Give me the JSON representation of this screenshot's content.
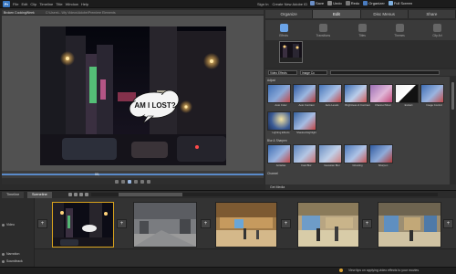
{
  "app": {
    "icon_letter": "Pr"
  },
  "menu": [
    "File",
    "Edit",
    "Clip",
    "Timeline",
    "Title",
    "Window",
    "Help"
  ],
  "topbar": {
    "sign_in": "Sign In",
    "create_id": "Create New Adobe ID"
  },
  "topbar_buttons": [
    {
      "label": "Save",
      "color": "#6b8fc7"
    },
    {
      "label": "Undo",
      "color": "#888888"
    },
    {
      "label": "Redo",
      "color": "#777777"
    },
    {
      "label": "Organizer",
      "color": "#4a7cc0"
    },
    {
      "label": "Full Screen",
      "color": "#7fb0e0"
    }
  ],
  "document": {
    "title": "Broken CookingWeek",
    "subtitle": "C:\\Users\\...\\My Videos\\Adobe\\Premiere Elements"
  },
  "video": {
    "speech_bubble": "AM I LOST?"
  },
  "timecode": {
    "marker": "00;"
  },
  "right_panel": {
    "tabs": [
      {
        "label": "Organize",
        "active": false
      },
      {
        "label": "Edit",
        "active": true
      },
      {
        "label": "Disc Menus",
        "active": false
      },
      {
        "label": "Share",
        "active": false
      }
    ],
    "subtabs": [
      {
        "label": "Effects",
        "active": true
      },
      {
        "label": "Transitions",
        "active": false
      },
      {
        "label": "Titles",
        "active": false
      },
      {
        "label": "Themes",
        "active": false
      },
      {
        "label": "Clip Art",
        "active": false
      }
    ],
    "filter": {
      "category": "Video Effects",
      "group": "Image Co",
      "search": ""
    },
    "sections": [
      {
        "name": "Adjust",
        "items": [
          "Auto Color",
          "Auto Contrast",
          "Auto Levels",
          "Brightness & Contrast",
          "Channel Mixer",
          "Extract",
          "Image Control",
          "Lighting Effects",
          "Shadow/Highlight"
        ]
      },
      {
        "name": "Blur & Sharpen",
        "items": [
          "Antialias",
          "Fast Blur",
          "Gaussian Blur",
          "Ghosting",
          "Sharpen"
        ]
      }
    ],
    "next_section": "Channel",
    "bottom_label": "Get Media"
  },
  "timeline": {
    "tabs": [
      {
        "label": "Timeline",
        "active": false
      },
      {
        "label": "Sceneline",
        "active": true
      }
    ],
    "tracks": [
      "Video",
      "Narration",
      "Soundtrack"
    ],
    "clip_count": 5
  },
  "status": {
    "text": "View tips on applying video effects to your movies"
  }
}
